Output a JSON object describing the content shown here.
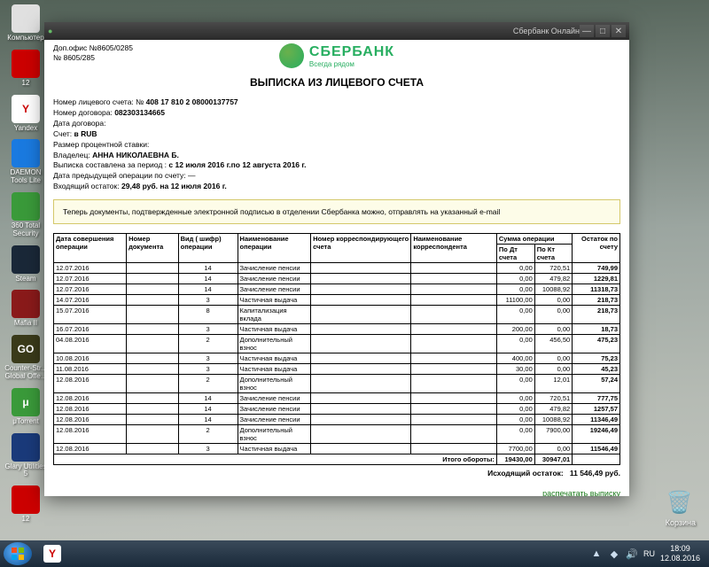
{
  "desktop_icons": [
    {
      "label": "Компьютер",
      "bg": "#e0e0e0"
    },
    {
      "label": "12",
      "bg": "#cc0000"
    },
    {
      "label": "Yandex",
      "bg": "#fff",
      "fg": "#cc0000",
      "glyph": "Y"
    },
    {
      "label": "DAEMON Tools Lite",
      "bg": "#1a7ae0"
    },
    {
      "label": "360 Total Security",
      "bg": "#3a9a3a"
    },
    {
      "label": "Steam",
      "bg": "#1a2838"
    },
    {
      "label": "Mafia II",
      "bg": "#8a1a1a"
    },
    {
      "label": "Counter-Str... Global Offe...",
      "bg": "#3a3a1a",
      "glyph": "GO"
    },
    {
      "label": "μTorrent",
      "bg": "#3a9a3a",
      "glyph": "μ"
    },
    {
      "label": "Glary Utilities 5",
      "bg": "#1a3a7a"
    },
    {
      "label": "12",
      "bg": "#cc0000"
    }
  ],
  "recycle_label": "Корзина",
  "browser": {
    "url_hint": "●",
    "title": "Сбербанк Онлайн"
  },
  "bank": {
    "logo_main": "СБЕРБАНК",
    "logo_sub": "Всегда рядом",
    "doc_title": "ВЫПИСКА ИЗ ЛИЦЕВОГО СЧЕТА",
    "meta": {
      "office": "Доп.офис №8605/0285",
      "office2": "№ 8605/285",
      "acc_label": "Номер лицевого счета: №",
      "acc": "408 17 810 2 08000137757",
      "contract_label": "Номер договора:",
      "contract": "082303134665",
      "contract_date_label": "Дата договора:",
      "currency_label": "Счет:",
      "currency": "в RUB",
      "rate_label": "Размер процентной ставки:",
      "owner_label": "Владелец:",
      "owner": "АННА НИКОЛАЕВНА Б.",
      "period_label": "Выписка составлена за период :",
      "period": "с 12 июля 2016 г.по 12 августа 2016 г.",
      "prev_op_label": "Дата предыдущей операции по счету:  —",
      "open_bal_label": "Входящий остаток:",
      "open_bal": "29,48 руб. на 12 июля 2016 г."
    },
    "notice": "Теперь документы, подтвержденные электронной подписью в отделении Сбербанка можно, отправлять на указанный e-mail",
    "columns": [
      "Дата совершения операции",
      "Номер документа",
      "Вид ( шифр) операции",
      "Наименование операции",
      "Номер корреспондирующего счета",
      "Наименование корреспондента",
      "По Дт счета",
      "По Кт счета",
      "Остаток по счету"
    ],
    "sumcol": "Сумма операции",
    "rows": [
      {
        "d": "12.07.2016",
        "doc": "",
        "code": "14",
        "name": "Зачисление пенсии",
        "dt": "0,00",
        "kt": "720,51",
        "bal": "749,99"
      },
      {
        "d": "12.07.2016",
        "doc": "",
        "code": "14",
        "name": "Зачисление пенсии",
        "dt": "0,00",
        "kt": "479,82",
        "bal": "1229,81"
      },
      {
        "d": "12.07.2016",
        "doc": "",
        "code": "14",
        "name": "Зачисление пенсии",
        "dt": "0,00",
        "kt": "10088,92",
        "bal": "11318,73"
      },
      {
        "d": "14.07.2016",
        "doc": "",
        "code": "3",
        "name": "Частичная выдача",
        "dt": "11100,00",
        "kt": "0,00",
        "bal": "218,73"
      },
      {
        "d": "15.07.2016",
        "doc": "",
        "code": "8",
        "name": "Капитализация вклада",
        "dt": "0,00",
        "kt": "0,00",
        "bal": "218,73"
      },
      {
        "d": "16.07.2016",
        "doc": "",
        "code": "3",
        "name": "Частичная выдача",
        "dt": "200,00",
        "kt": "0,00",
        "bal": "18,73"
      },
      {
        "d": "04.08.2016",
        "doc": "",
        "code": "2",
        "name": "Дополнительный взнос",
        "dt": "0,00",
        "kt": "456,50",
        "bal": "475,23"
      },
      {
        "d": "10.08.2016",
        "doc": "",
        "code": "3",
        "name": "Частичная выдача",
        "dt": "400,00",
        "kt": "0,00",
        "bal": "75,23"
      },
      {
        "d": "11.08.2016",
        "doc": "",
        "code": "3",
        "name": "Частичная выдача",
        "dt": "30,00",
        "kt": "0,00",
        "bal": "45,23"
      },
      {
        "d": "12.08.2016",
        "doc": "",
        "code": "2",
        "name": "Дополнительный взнос",
        "dt": "0,00",
        "kt": "12,01",
        "bal": "57,24"
      },
      {
        "d": "12.08.2016",
        "doc": "",
        "code": "14",
        "name": "Зачисление пенсии",
        "dt": "0,00",
        "kt": "720,51",
        "bal": "777,75"
      },
      {
        "d": "12.08.2016",
        "doc": "",
        "code": "14",
        "name": "Зачисление пенсии",
        "dt": "0,00",
        "kt": "479,82",
        "bal": "1257,57"
      },
      {
        "d": "12.08.2016",
        "doc": "",
        "code": "14",
        "name": "Зачисление пенсии",
        "dt": "0,00",
        "kt": "10088,92",
        "bal": "11346,49"
      },
      {
        "d": "12.08.2016",
        "doc": "",
        "code": "2",
        "name": "Дополнительный взнос",
        "dt": "0,00",
        "kt": "7900,00",
        "bal": "19246,49"
      },
      {
        "d": "12.08.2016",
        "doc": "",
        "code": "3",
        "name": "Частичная выдача",
        "dt": "7700,00",
        "kt": "0,00",
        "bal": "11546,49"
      }
    ],
    "totals_label": "Итого обороты:",
    "totals_dt": "19430,00",
    "totals_kt": "30947,01",
    "closing_label": "Исходящий остаток:",
    "closing": "11 546,49 руб.",
    "print": "распечатать выписку"
  },
  "tray": {
    "lang": "RU",
    "time": "18:09",
    "date": "12.08.2016"
  }
}
